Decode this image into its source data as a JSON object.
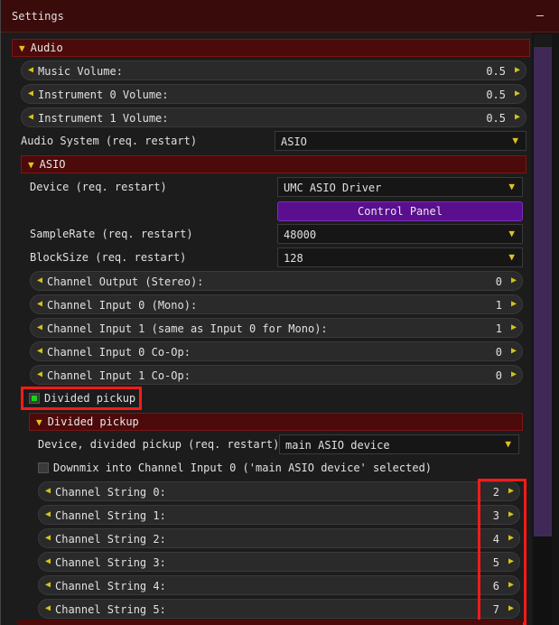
{
  "window": {
    "title": "Settings",
    "collapse_glyph": "–"
  },
  "audio": {
    "header": "Audio",
    "music_volume": {
      "label": "Music Volume:",
      "value": "0.5"
    },
    "instrument0_volume": {
      "label": "Instrument 0 Volume:",
      "value": "0.5"
    },
    "instrument1_volume": {
      "label": "Instrument 1 Volume:",
      "value": "0.5"
    },
    "audio_system": {
      "label": "Audio System (req. restart)",
      "value": "ASIO"
    }
  },
  "asio": {
    "header": "ASIO",
    "device": {
      "label": "Device (req. restart)",
      "value": "UMC ASIO Driver"
    },
    "control_panel": "Control Panel",
    "samplerate": {
      "label": "SampleRate (req. restart)",
      "value": "48000"
    },
    "blocksize": {
      "label": "BlockSize (req. restart)",
      "value": "128"
    },
    "channel_output": {
      "label": "Channel Output (Stereo):",
      "value": "0"
    },
    "channel_input0": {
      "label": "Channel Input 0 (Mono):",
      "value": "1"
    },
    "channel_input1": {
      "label": "Channel Input 1 (same as Input 0 for Mono):",
      "value": "1"
    },
    "channel_input0_coop": {
      "label": "Channel Input 0 Co-Op:",
      "value": "0"
    },
    "channel_input1_coop": {
      "label": "Channel Input 1 Co-Op:",
      "value": "0"
    },
    "divided_pickup_checkbox": {
      "label": "Divided pickup",
      "checked": true
    }
  },
  "divided_pickup": {
    "header": "Divided pickup",
    "device": {
      "label": "Device, divided pickup (req. restart)",
      "value": "main ASIO device"
    },
    "downmix": {
      "label": "Downmix into Channel Input 0 ('main ASIO device' selected)",
      "checked": false
    },
    "strings": [
      {
        "label": "Channel String 0:",
        "value": "2"
      },
      {
        "label": "Channel String 1:",
        "value": "3"
      },
      {
        "label": "Channel String 2:",
        "value": "4"
      },
      {
        "label": "Channel String 3:",
        "value": "5"
      },
      {
        "label": "Channel String 4:",
        "value": "6"
      },
      {
        "label": "Channel String 5:",
        "value": "7"
      }
    ]
  },
  "colors": {
    "accent_yellow": "#e2c21f",
    "header_red": "#4d0a0a",
    "button_purple": "#5a0f8e",
    "highlight_red": "#ff1a1a",
    "check_green": "#19d219"
  }
}
